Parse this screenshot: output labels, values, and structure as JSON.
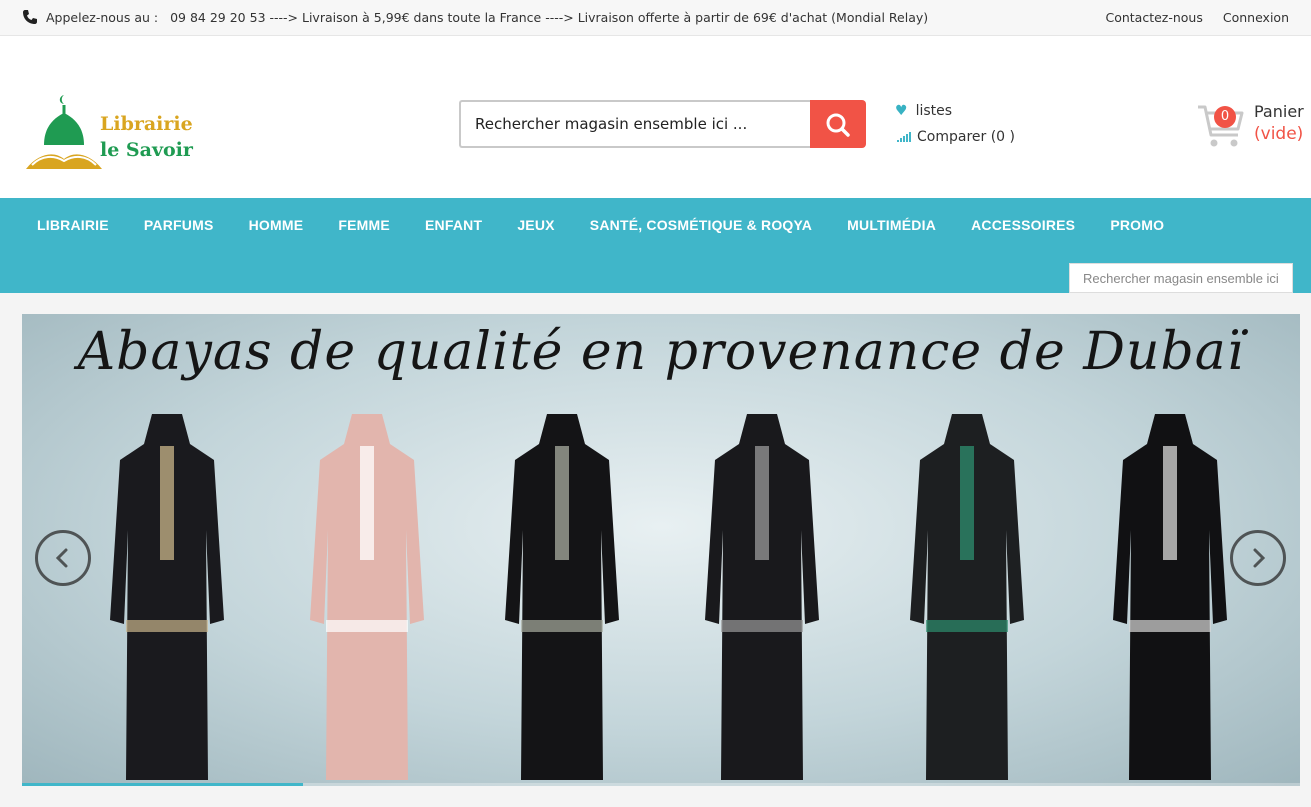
{
  "topbar": {
    "announce_label": "Appelez-nous au :",
    "announce_text": "09 84 29 20 53 ----> Livraison à 5,99€ dans toute la France ----> Livraison offerte à partir de 69€ d'achat (Mondial Relay)",
    "contact": "Contactez-nous",
    "login": "Connexion"
  },
  "logo": {
    "line1": "Librairie",
    "line2": "le Savoir",
    "gold": "#d9a520",
    "green": "#1f9b52"
  },
  "search": {
    "placeholder": "Rechercher magasin ensemble ici ..."
  },
  "header_links": {
    "wishlist": "listes",
    "compare": "Comparer (0 )"
  },
  "cart": {
    "count": "0",
    "label": "Panier",
    "status": "(vide)"
  },
  "nav": {
    "items": [
      "LIBRAIRIE",
      "PARFUMS",
      "HOMME",
      "FEMME",
      "ENFANT",
      "JEUX",
      "SANTÉ, COSMÉTIQUE & ROQYA",
      "MULTIMÉDIA",
      "ACCESSOIRES",
      "PROMO"
    ],
    "search_placeholder": "Rechercher magasin ensemble ici"
  },
  "slider": {
    "title": "Abayas de qualité en provenance de Dubaï",
    "progress": 0.22,
    "abaya_colors": [
      "#1a1a1e",
      "#e2b5ad",
      "#141416",
      "#19191c",
      "#1d1f21",
      "#111113"
    ],
    "trim_colors": [
      "#c9b58a",
      "#ffffff",
      "#a8aca0",
      "#9a9a9a",
      "#2e8f6f",
      "#d8d8d8"
    ]
  },
  "colors": {
    "accent": "#40b6c9",
    "red": "#f15346"
  }
}
